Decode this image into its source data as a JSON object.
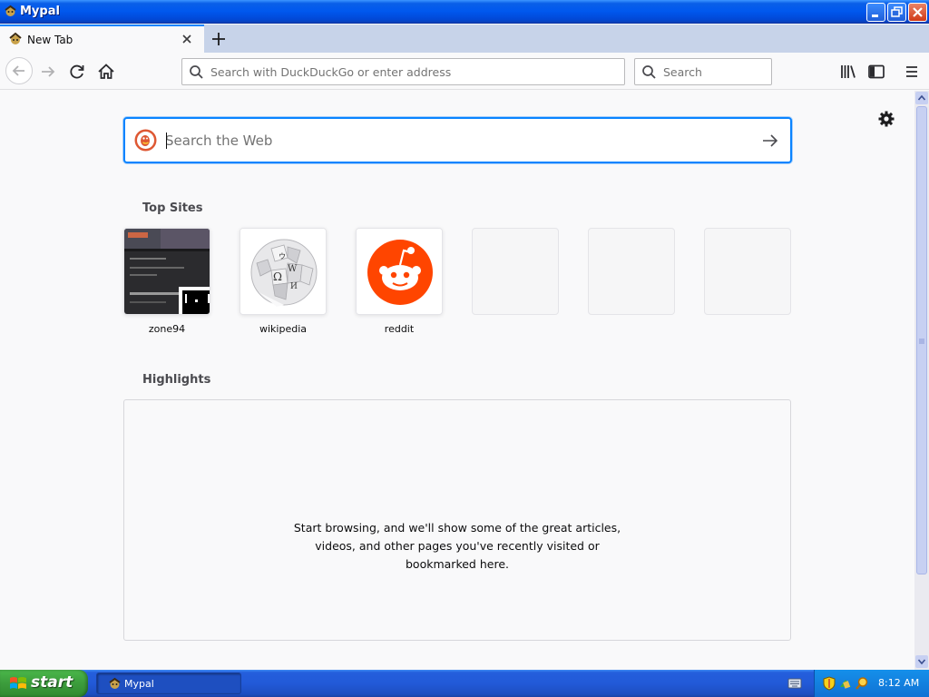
{
  "window": {
    "title": "Mypal"
  },
  "tabs": [
    {
      "label": "New Tab"
    }
  ],
  "navbar": {
    "url_placeholder": "Search with DuckDuckGo or enter address",
    "search_placeholder": "Search"
  },
  "newtab": {
    "websearch_placeholder": "Search the Web",
    "top_sites_title": "Top Sites",
    "top_sites": [
      {
        "label": "zone94"
      },
      {
        "label": "wikipedia"
      },
      {
        "label": "reddit"
      },
      {
        "label": ""
      },
      {
        "label": ""
      },
      {
        "label": ""
      }
    ],
    "highlights_title": "Highlights",
    "highlights_empty": [
      "Start browsing, and we'll show some of the great articles,",
      "videos, and other pages you've recently visited or",
      "bookmarked here."
    ]
  },
  "taskbar": {
    "start_label": "start",
    "task_label": "Mypal",
    "clock": "8:12 AM"
  },
  "colors": {
    "accent": "#0a84ff",
    "reddit": "#ff4500",
    "xp_blue": "#245edc",
    "xp_green": "#3c9c3c"
  }
}
